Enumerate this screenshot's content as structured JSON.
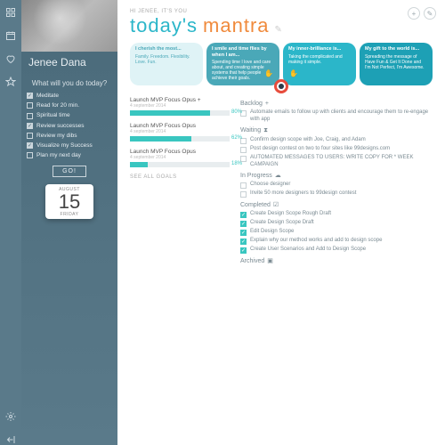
{
  "user": {
    "greeting": "HI JENEE, IT'S YOU",
    "name": "Jenee Dana"
  },
  "title": {
    "main": "today's",
    "accent": "mantra"
  },
  "rail_icons": [
    "grid",
    "calendar",
    "heart",
    "star",
    "gear",
    "logout"
  ],
  "sidebar": {
    "prompt": "What will you do today?",
    "todos": [
      {
        "label": "Meditate",
        "done": true
      },
      {
        "label": "Read for 20 min.",
        "done": false
      },
      {
        "label": "Spiritual time",
        "done": false
      },
      {
        "label": "Review successes",
        "done": true
      },
      {
        "label": "Review my dibs",
        "done": false
      },
      {
        "label": "Visualize my Success",
        "done": true
      },
      {
        "label": "Plan my next day",
        "done": false
      }
    ],
    "go": "GO!",
    "calendar": {
      "month": "AUGUST",
      "day": "15",
      "weekday": "FRIDAY"
    }
  },
  "mantras": [
    {
      "head": "I cherish the most...",
      "body": "Family. Freedom. Flexibility. Love. Fun."
    },
    {
      "head": "I smile and time flies by when I am...",
      "body": "Spending time I love and care about, and creating simple systems that help people achieve their goals."
    },
    {
      "head": "My inner-brilliance is...",
      "body": "Taking the complicated and making it simple."
    },
    {
      "head": "My gift to the world is...",
      "body": "Spreading the message of Have Fun & Get It Done and I'm Not Perfect, I'm Awesome."
    }
  ],
  "goals": [
    {
      "title": "Launch MVP Focus Opus +",
      "date": "4 september 2014",
      "pct": 80
    },
    {
      "title": "Launch MVP Focus Opus",
      "date": "4 september 2014",
      "pct": 62
    },
    {
      "title": "Launch MVP Focus Opus",
      "date": "4 september 2014",
      "pct": 18
    }
  ],
  "see_all": "SEE ALL GOALS",
  "sections": {
    "backlog": {
      "label": "Backlog",
      "items": [
        "Automate emails to follow up with clients and encourage them to re-engage with app"
      ]
    },
    "waiting": {
      "label": "Waiting",
      "items": [
        "Confirm design scope with Joe, Craig, and Adam",
        "Post design contest on two to four sites like 99designs.com",
        "AUTOMATED MESSAGES TO USERS: WRITE COPY FOR * WEEK CAMPAIGN"
      ]
    },
    "inprogress": {
      "label": "In Progress",
      "items": [
        "Choose designer",
        "Invite 50 more designers to 99design contest"
      ]
    },
    "completed": {
      "label": "Completed",
      "items": [
        "Create Design Scope Rough Draft",
        "Create Design Scope Draft",
        "Edit Design Scope",
        "Explain why our method works and add to design scope",
        "Create User Scenarios and Add to Design Scope"
      ]
    },
    "archived": {
      "label": "Archived"
    }
  }
}
